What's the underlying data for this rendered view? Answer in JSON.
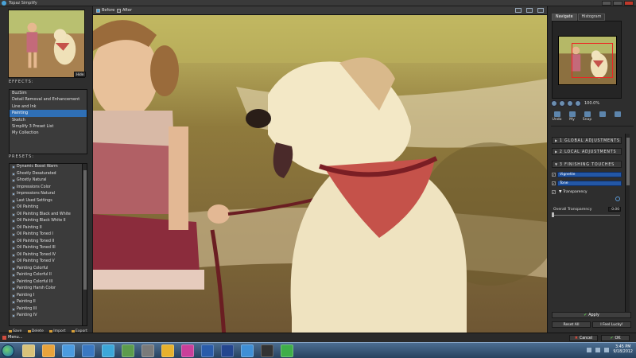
{
  "window": {
    "title": "Topaz Simplify"
  },
  "left": {
    "hide_label": "Hide",
    "effects_label": "EFFECTS:",
    "effects": [
      "BuzSim",
      "Detail Removal and Enhancement",
      "Line and Ink",
      "Painting",
      "Sketch",
      "Simplify 3 Preset List",
      "My Collection"
    ],
    "selected_effect_index": 3,
    "presets_label": "PRESETS:",
    "presets": [
      "Dynamic Boost Warm",
      "Ghostly Desaturated",
      "Ghostly Natural",
      "Impressions Color",
      "Impressions Natural",
      "Last Used Settings",
      "Oil Painting",
      "Oil Painting Black and White",
      "Oil Painting Black White II",
      "Oil Painting II",
      "Oil Painting Toned I",
      "Oil Painting Toned II",
      "Oil Painting Toned III",
      "Oil Painting Toned IV",
      "Oil Painting Toned V",
      "Painting Colorful",
      "Painting Colorful II",
      "Painting Colorful III",
      "Painting Harsh Color",
      "Painting I",
      "Painting II",
      "Painting III",
      "Painting IV"
    ],
    "actions": [
      "Save",
      "Delete",
      "Import",
      "Export"
    ]
  },
  "center": {
    "before_label": "Before",
    "after_label": "After"
  },
  "right": {
    "tabs": [
      "Navigate",
      "Histogram"
    ],
    "zoom_value": "100.0%",
    "tools": [
      "Undo",
      "My",
      "Snap",
      "",
      ""
    ],
    "sections": {
      "global": "1 GLOBAL ADJUSTMENTS",
      "local": "2 LOCAL ADJUSTMENTS",
      "finishing": "3 FINISHING TOUCHES"
    },
    "finishing_items": [
      "Vignette",
      "Tone",
      "Transparency"
    ],
    "slider_label": "Overall Transparency",
    "slider_value": "0.00",
    "apply_label": "Apply",
    "reset_label": "Reset All",
    "lucky_label": "I Feel Lucky!"
  },
  "bottom": {
    "menu_label": "Menu...",
    "cancel_label": "Cancel",
    "ok_label": "OK"
  },
  "taskbar": {
    "time": "3:45 PM",
    "date": "9/18/2012",
    "icons": [
      "explorer-icon",
      "media-player-icon",
      "internet-explorer-icon",
      "check-icon",
      "wifi-icon",
      "folder-icon",
      "tools-icon",
      "chrome-icon",
      "app-icon",
      "photoshop-icon",
      "photoshop-icon-2",
      "snowflake-icon",
      "fx-icon",
      "green-circle-icon"
    ],
    "icon_colors": [
      "#d8c27a",
      "#e8a33c",
      "#4b9be0",
      "#3a78c2",
      "#3ca7d9",
      "#5c9c4c",
      "#7a7a7a",
      "#e6b12e",
      "#c93f9a",
      "#2a5caa",
      "#24468f",
      "#3f8fd6",
      "#333333",
      "#3fae49"
    ]
  }
}
